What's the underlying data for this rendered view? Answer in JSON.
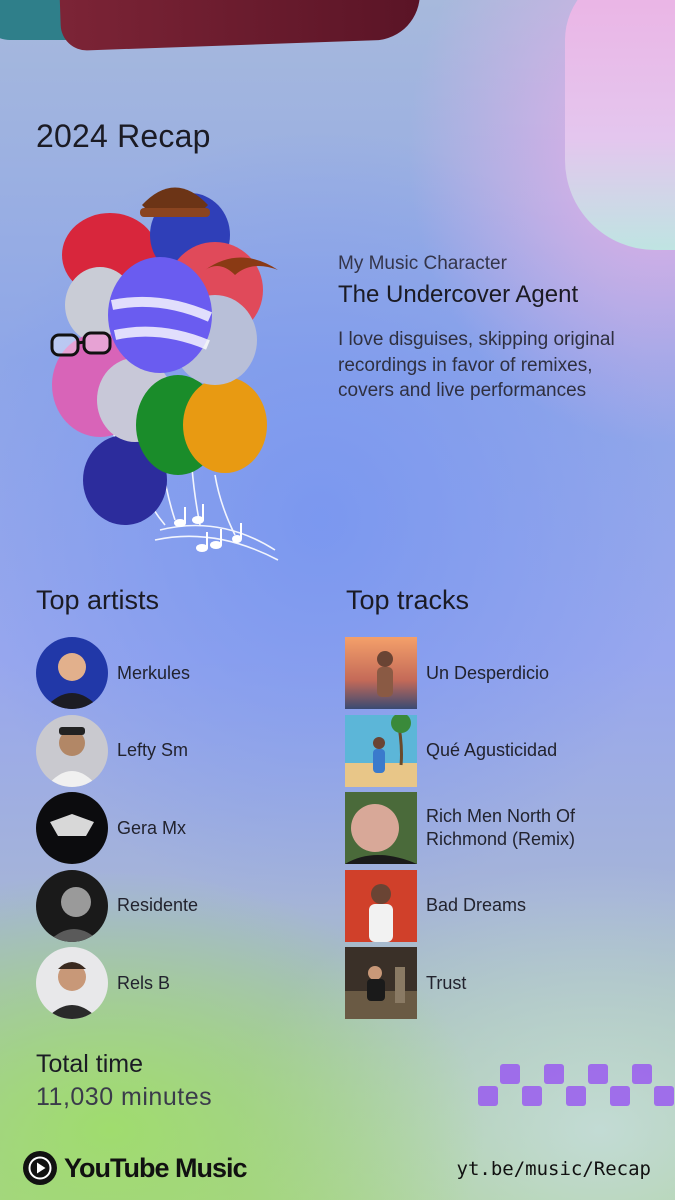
{
  "title": "2024 Recap",
  "character": {
    "subtitle": "My Music Character",
    "name": "The Undercover Agent",
    "description": "I love disguises, skipping original recordings in favor of remixes, covers and live performances"
  },
  "artists": {
    "heading": "Top artists",
    "items": [
      {
        "name": "Merkules"
      },
      {
        "name": "Lefty Sm"
      },
      {
        "name": "Gera Mx"
      },
      {
        "name": "Residente"
      },
      {
        "name": "Rels B"
      }
    ]
  },
  "tracks": {
    "heading": "Top tracks",
    "items": [
      {
        "name": "Un Desperdicio"
      },
      {
        "name": "Qué Agusticidad"
      },
      {
        "name": "Rich Men North Of\nRichmond (Remix)"
      },
      {
        "name": "Bad Dreams"
      },
      {
        "name": "Trust"
      }
    ]
  },
  "total": {
    "label": "Total time",
    "value": "11,030 minutes"
  },
  "footer": {
    "brand": "YouTube Music",
    "url": "yt.be/music/Recap",
    "logo_icon": "youtube-music-logo-icon"
  },
  "colors": {
    "accent_burgundy": "#7c2436",
    "accent_pink": "#ecb2e4",
    "checker": "#9a5cf0"
  }
}
